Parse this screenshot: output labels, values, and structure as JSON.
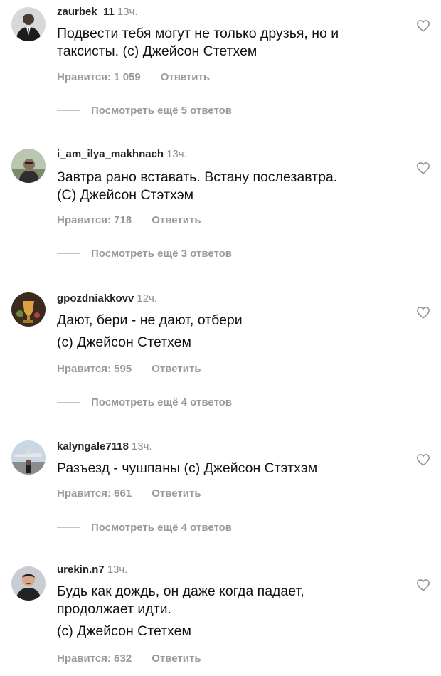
{
  "comments": [
    {
      "username": "zaurbek_11",
      "time": "13ч.",
      "lines": [
        "Подвести тебя могут не только друзья, но и",
        "таксисты. (с) Джейсон Стетхем"
      ],
      "likes": "Нравится: 1 059",
      "reply": "Ответить",
      "view_replies": "Посмотреть ещё 5 ответов",
      "avatar": "man-in-suit-avatar"
    },
    {
      "username": "i_am_ilya_makhnach",
      "time": "13ч.",
      "lines": [
        "Завтра рано вставать. Встану послезавтра.",
        "(С) Джейсон Стэтхэм"
      ],
      "likes": "Нравится: 718",
      "reply": "Ответить",
      "view_replies": "Посмотреть ещё 3 ответов",
      "avatar": "man-outdoors-avatar"
    },
    {
      "username": "gpozdniakkovv",
      "time": "12ч.",
      "lines": [
        "Дают, бери - не дают, отбери",
        "(с) Джейсон Стетхем"
      ],
      "likes": "Нравится: 595",
      "reply": "Ответить",
      "view_replies": "Посмотреть ещё 4 ответов",
      "avatar": "trophy-avatar"
    },
    {
      "username": "kalyngale7118",
      "time": "13ч.",
      "lines": [
        "Разъезд - чушпаны (с) Джейсон Стэтхэм"
      ],
      "likes": "Нравится: 661",
      "reply": "Ответить",
      "view_replies": "Посмотреть ещё 4 ответов",
      "avatar": "airplane-avatar"
    },
    {
      "username": "urekin.n7",
      "time": "13ч.",
      "lines": [
        "Будь как дождь, он даже когда падает,",
        "продолжает идти.",
        "(с) Джейсон Стетхем"
      ],
      "likes": "Нравится: 632",
      "reply": "Ответить",
      "avatar": "smiling-man-avatar"
    }
  ],
  "icons": {
    "like": "heart-outline-icon"
  },
  "colors": {
    "text": "#111111",
    "username": "#262626",
    "muted": "#9a9a9a",
    "divider": "#c4c4c4"
  }
}
